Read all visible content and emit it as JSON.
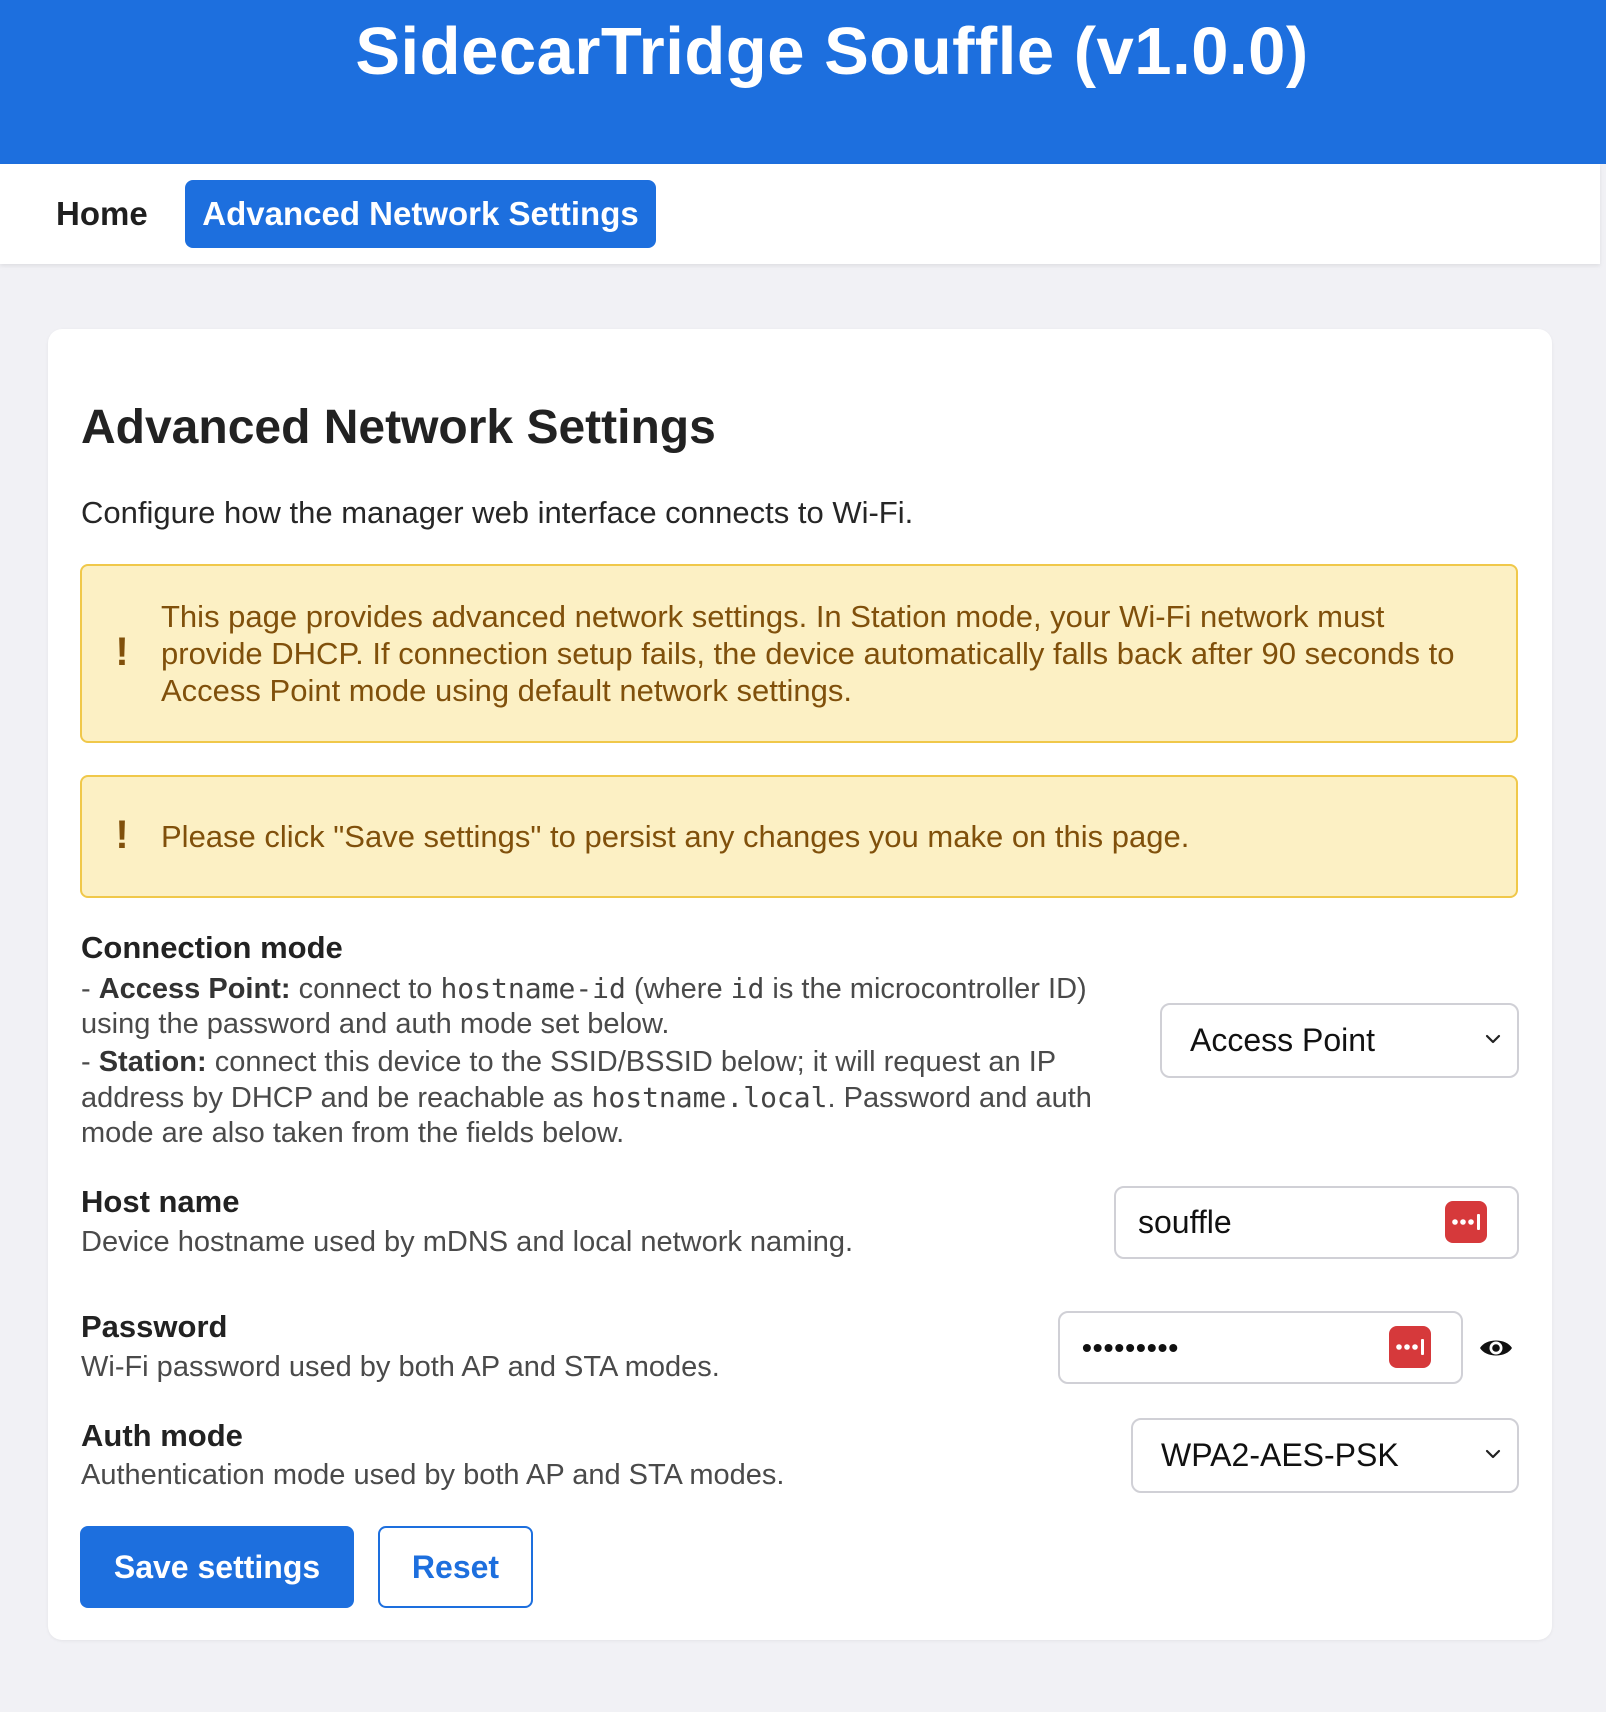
{
  "header": {
    "title": "SidecarTridge Souffle (v1.0.0)"
  },
  "nav": {
    "items": [
      {
        "label": "Home"
      },
      {
        "label": "Advanced Network Settings",
        "active": true
      }
    ]
  },
  "page": {
    "title": "Advanced Network Settings",
    "description": "Configure how the manager web interface connects to Wi-Fi."
  },
  "alerts": [
    {
      "icon": "!",
      "text": "This page provides advanced network settings. In Station mode, your Wi-Fi network must provide DHCP. If connection setup fails, the device automatically falls back after 90 seconds to Access Point mode using default network settings."
    },
    {
      "icon": "!",
      "text": "Please click \"Save settings\" to persist any changes you make on this page."
    }
  ],
  "settings": {
    "connection_mode": {
      "label": "Connection mode",
      "ap_prefix": "- ",
      "ap_label": "Access Point:",
      "ap_text_1": " connect to ",
      "ap_code_1": "hostname-id",
      "ap_text_2": " (where ",
      "ap_code_2": "id",
      "ap_text_3": " is the microcontroller ID) using the password and auth mode set below.",
      "sta_prefix": "- ",
      "sta_label": "Station:",
      "sta_text_1": " connect this device to the SSID/BSSID below; it will request an IP address by DHCP and be reachable as ",
      "sta_code": "hostname.local",
      "sta_text_2": ". Password and auth mode are also taken from the fields below.",
      "value": "Access Point"
    },
    "host_name": {
      "label": "Host name",
      "description": "Device hostname used by mDNS and local network naming.",
      "value": "souffle"
    },
    "password": {
      "label": "Password",
      "description": "Wi-Fi password used by both AP and STA modes.",
      "masked_value": "•••••••••"
    },
    "auth_mode": {
      "label": "Auth mode",
      "description": "Authentication mode used by both AP and STA modes.",
      "value": "WPA2-AES-PSK"
    }
  },
  "buttons": {
    "save": "Save settings",
    "reset": "Reset"
  },
  "icons": {
    "password_manager": "password-manager-icon",
    "show_password": "eye-icon",
    "dropdown": "chevron-down-icon"
  },
  "colors": {
    "primary": "#1d6fde",
    "alert_bg": "#fcf0c4",
    "alert_border": "#f0c84a",
    "alert_text": "#80500b",
    "password_manager": "#d6393b"
  }
}
